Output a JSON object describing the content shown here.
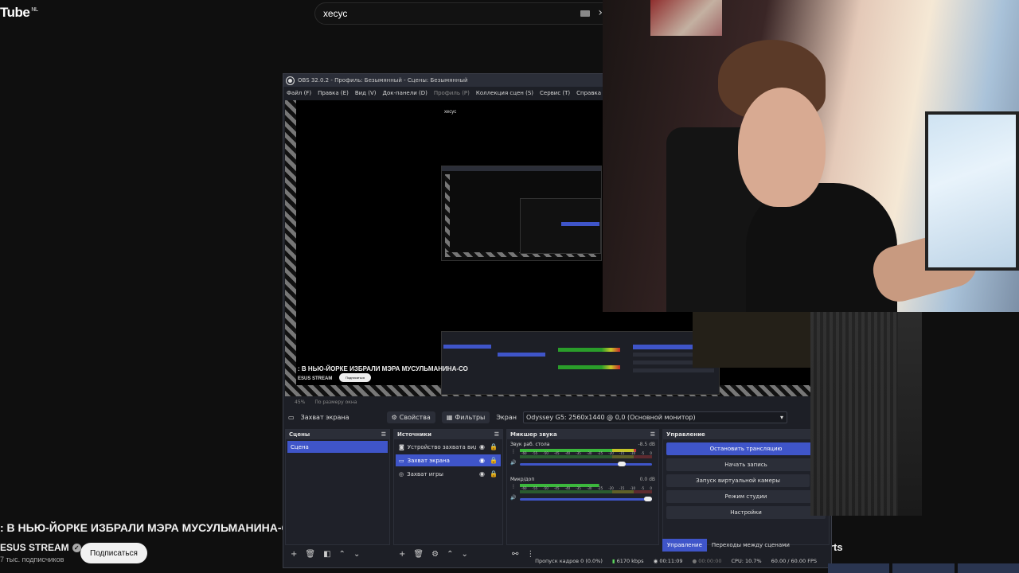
{
  "youtube": {
    "logo_text": "Tube",
    "region": "NL",
    "search_value": "хесус",
    "video_title": ": В НЬЮ-ЙОРКЕ ИЗБРАЛИ МЭРА МУСУЛЬМАНИНА-СО",
    "channel_name": "ESUS STREAM",
    "subscribers": "7 тыс. подписчиков",
    "subscribe_label": "Подписаться",
    "shorts_label": "rts"
  },
  "obs": {
    "window_title": "OBS 32.0.2 - Профиль: Безымянный - Сцены: Безымянный",
    "menu": [
      {
        "label": "Файл (F)",
        "dim": false
      },
      {
        "label": "Правка (E)",
        "dim": false
      },
      {
        "label": "Вид (V)",
        "dim": false
      },
      {
        "label": "Док-панели (D)",
        "dim": false
      },
      {
        "label": "Профиль (P)",
        "dim": true
      },
      {
        "label": "Коллекция сцен (S)",
        "dim": false
      },
      {
        "label": "Сервис (T)",
        "dim": false
      },
      {
        "label": "Справка (H)",
        "dim": false
      }
    ],
    "preview": {
      "search_text": "хесус",
      "title_text": ": В НЬЮ-ЙОРКЕ ИЗБРАЛИ МЭРА МУСУЛЬМАНИНА-СО",
      "channel_text": "ESUS STREAM",
      "subscribe_text": "Подписаться",
      "zoom": "45%",
      "fit_label": "По размеру окна"
    },
    "source_toolbar": {
      "source_name": "Захват экрана",
      "properties_label": "Свойства",
      "filters_label": "Фильтры",
      "screen_label": "Экран",
      "monitor_value": "Odyssey G5: 2560x1440 @ 0,0 (Основной монитор)"
    },
    "scenes": {
      "title": "Сцены",
      "items": [
        "Сцена"
      ]
    },
    "sources": {
      "title": "Источники",
      "items": [
        {
          "label": "Устройство захвата видео",
          "selected": false
        },
        {
          "label": "Захват экрана",
          "selected": true
        },
        {
          "label": "Захват игры",
          "selected": false
        }
      ]
    },
    "mixer": {
      "title": "Микшер звука",
      "scale": [
        "-60",
        "-55",
        "-50",
        "-45",
        "-40",
        "-35",
        "-30",
        "-25",
        "-20",
        "-15",
        "-10",
        "-5",
        "0"
      ],
      "channels": [
        {
          "name": "Звук раб. стола",
          "db": "-8.5 dB",
          "level": 0.88,
          "volume": 0.8
        },
        {
          "name": "Микр/доп",
          "db": "0.0 dB",
          "level": 0.6,
          "volume": 1.0
        }
      ]
    },
    "controls": {
      "title": "Управление",
      "buttons": [
        {
          "label": "Остановить трансляцию",
          "primary": true
        },
        {
          "label": "Начать запись",
          "primary": false
        },
        {
          "label": "Запуск виртуальной камеры",
          "primary": false
        },
        {
          "label": "Режим студии",
          "primary": false
        },
        {
          "label": "Настройки",
          "primary": false
        }
      ],
      "tab_controls": "Управление",
      "tab_transitions": "Переходы между сценами"
    },
    "status": {
      "dropped_frames": "Пропуск кадров 0 (0.0%)",
      "bitrate": "6170 kbps",
      "stream_time": "00:11:09",
      "record_time": "00:00:00",
      "cpu": "CPU: 10.7%",
      "fps": "60.00 / 60.00 FPS"
    }
  }
}
